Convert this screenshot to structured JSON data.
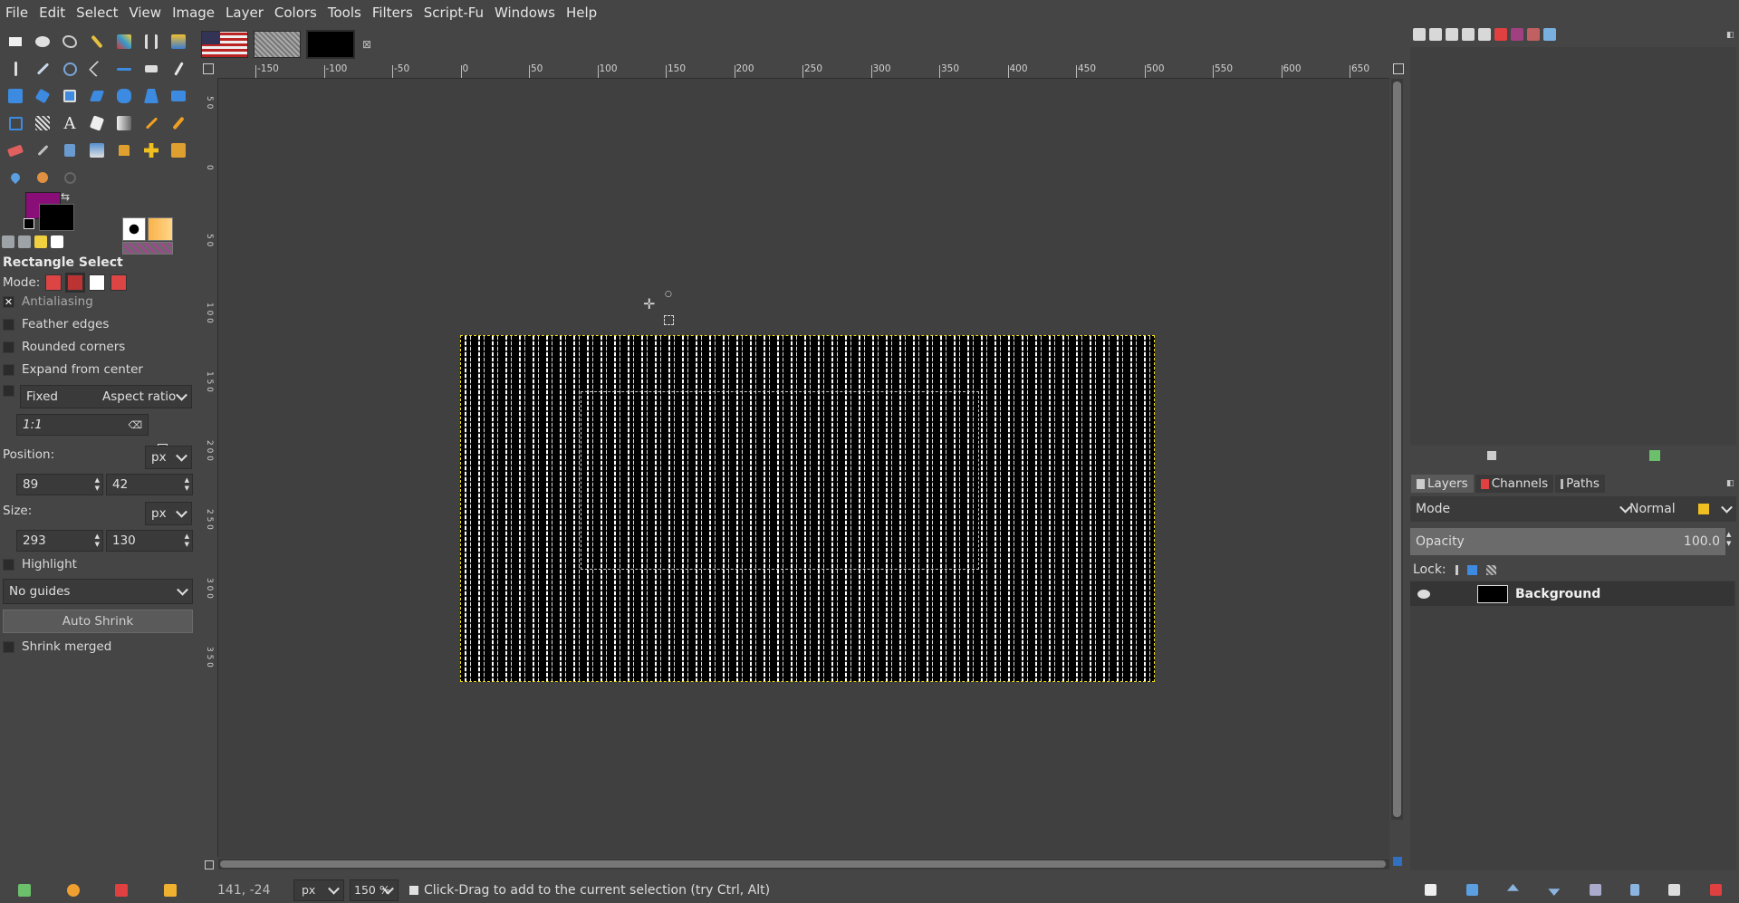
{
  "menu": [
    "File",
    "Edit",
    "Select",
    "View",
    "Image",
    "Layer",
    "Colors",
    "Tools",
    "Filters",
    "Script-Fu",
    "Windows",
    "Help"
  ],
  "tool_options": {
    "title": "Rectangle Select",
    "mode_label": "Mode:",
    "antialiasing": "Antialiasing",
    "feather": "Feather edges",
    "rounded": "Rounded corners",
    "expand": "Expand from center",
    "fixed_label": "Fixed",
    "fixed_value": "Aspect ratio",
    "ratio_value": "1:1",
    "position_label": "Position:",
    "position_unit": "px",
    "position_x": "89",
    "position_y": "42",
    "size_label": "Size:",
    "size_unit": "px",
    "size_w": "293",
    "size_h": "130",
    "highlight": "Highlight",
    "guides": "No guides",
    "auto_shrink": "Auto Shrink",
    "shrink_merged": "Shrink merged"
  },
  "colors": {
    "foreground": "#8a0e78",
    "background": "#000000",
    "accent": "#f0e020"
  },
  "ruler_h": [
    "-150",
    "-100",
    "-50",
    "0",
    "50",
    "100",
    "150",
    "200",
    "250",
    "300",
    "350",
    "400",
    "450",
    "500",
    "550",
    "600",
    "650"
  ],
  "ruler_v": [
    "5 0",
    "0",
    "5 0",
    "1 0 0",
    "1 5 0",
    "2 0 0",
    "2 5 0",
    "3 0 0",
    "3 5 0"
  ],
  "status": {
    "coords": "141, -24",
    "unit": "px",
    "zoom": "150 %",
    "message": "Click-Drag to add to the current selection (try Ctrl, Alt)"
  },
  "layers_panel": {
    "tabs": [
      "Layers",
      "Channels",
      "Paths"
    ],
    "mode_label": "Mode",
    "mode_value": "Normal",
    "opacity_label": "Opacity",
    "opacity_value": "100.0",
    "lock_label": "Lock:",
    "layer_name": "Background"
  }
}
